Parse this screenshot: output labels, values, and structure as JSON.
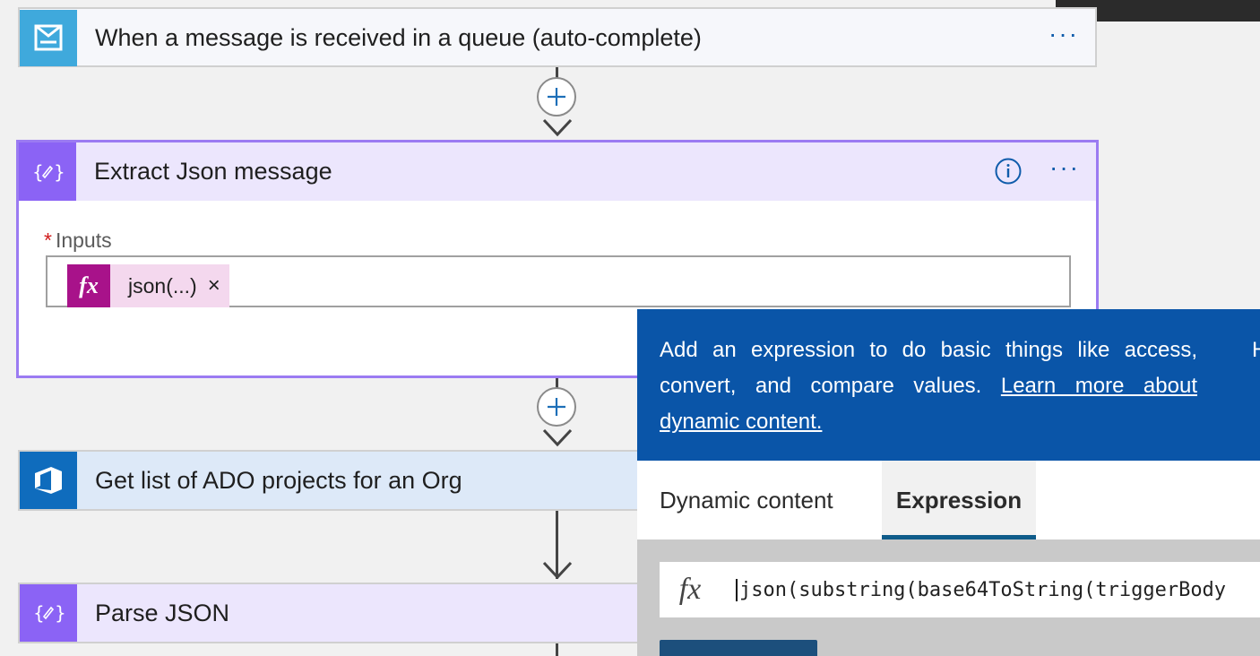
{
  "trigger": {
    "title": "When a message is received in a queue (auto-complete)",
    "more": "···"
  },
  "extract": {
    "title": "Extract Json message",
    "more": "···",
    "inputs_required": "*",
    "inputs_label": "Inputs",
    "token_text": "json(...)",
    "token_fx": "fx",
    "token_remove": "×"
  },
  "ado": {
    "title": "Get list of ADO projects for an Org"
  },
  "parse": {
    "title": "Parse JSON"
  },
  "popup": {
    "description": "Add an expression to do basic things like access, convert, and compare values.",
    "link": "Learn more about dynamic content.",
    "cut_text": "H",
    "tabs": [
      "Dynamic content",
      "Expression"
    ],
    "active_tab": "Expression",
    "expr_fx": "fx",
    "expression": "json(substring(base64ToString(triggerBody"
  },
  "colors": {
    "trigger_icon": "#3fa9dc",
    "compose_icon": "#8b63f5",
    "ado_icon": "#0f6cbd",
    "popup_blue": "#0a55a8",
    "token_fx": "#a8128a"
  }
}
